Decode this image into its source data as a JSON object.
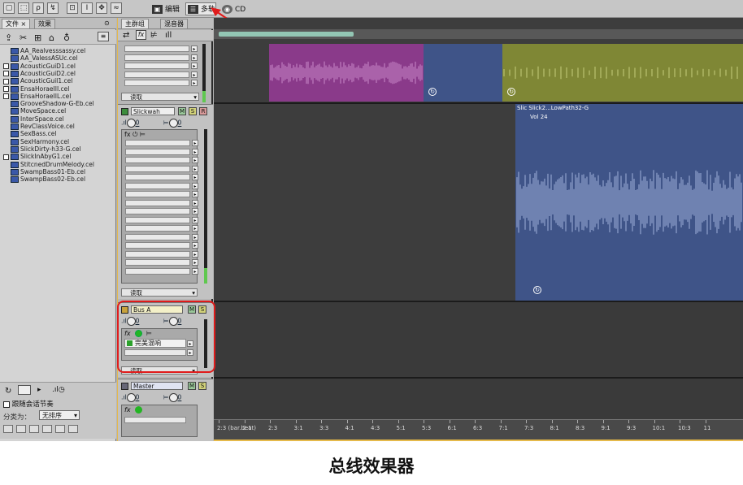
{
  "toolbar": {
    "edit_label": "编辑",
    "multitrack_label": "多轨",
    "cd_label": "CD"
  },
  "files_panel": {
    "tab_files": "文件",
    "tab_effects": "效果",
    "items": [
      {
        "name": "AA_Realvesssassy.cel",
        "checked": false
      },
      {
        "name": "AA_ValessASUc.cel",
        "checked": false
      },
      {
        "name": "AcousticGuiD1.cel",
        "checked": true
      },
      {
        "name": "AcousticGuiD2.cel",
        "checked": true
      },
      {
        "name": "AcousticGuiI1.cel",
        "checked": true
      },
      {
        "name": "EnsaHoraeIII.cel",
        "checked": true
      },
      {
        "name": "EnsaHoraeIIL.cel",
        "checked": true
      },
      {
        "name": "GrooveShadow-G-Eb.cel",
        "checked": false
      },
      {
        "name": "MoveSpace.cel",
        "checked": false
      },
      {
        "name": "InterSpace.cel",
        "checked": false
      },
      {
        "name": "RevClassVoice.cel",
        "checked": false
      },
      {
        "name": "SexBass.cel",
        "checked": false
      },
      {
        "name": "SexHarmony.cel",
        "checked": false
      },
      {
        "name": "SlickDirty-h33-G.cel",
        "checked": false
      },
      {
        "name": "SlickInAbyG1.cel",
        "checked": true
      },
      {
        "name": "StitcnedDrumMelody.cel",
        "checked": false
      },
      {
        "name": "SwampBass01-Eb.cel",
        "checked": false
      },
      {
        "name": "SwampBass02-Eb.cel",
        "checked": false
      }
    ],
    "follow_label": "跟随会话节奏",
    "sort_label": "分类为：",
    "sort_value": "无排序"
  },
  "mixer": {
    "tab_main": "主群组",
    "tab_send": "混音器",
    "read_label": "读取",
    "track2_name": "Slickwah",
    "bus_name": "Bus A",
    "bus_effect": "完美混响",
    "master_name": "Master",
    "vol_zero": "0"
  },
  "timeline": {
    "clip_label": "Slic  Slick2...LowPath32-G",
    "clip_sub": "Vol 24",
    "ruler_labels": [
      "2:3 (bar.beat)",
      "2:1",
      "2:3",
      "3:1",
      "3:3",
      "4:1",
      "4:3",
      "5:1",
      "5:3",
      "6:1",
      "6:3",
      "7:1",
      "7:3",
      "8:1",
      "8:3",
      "9:1",
      "9:3",
      "10:1",
      "10:3",
      "11"
    ]
  },
  "colors": {
    "clip_purple": "#8a3a8a",
    "clip_blue": "#3f5488",
    "clip_olive": "#7f8735",
    "highlight": "#e01b1b"
  },
  "caption": "总线效果器"
}
